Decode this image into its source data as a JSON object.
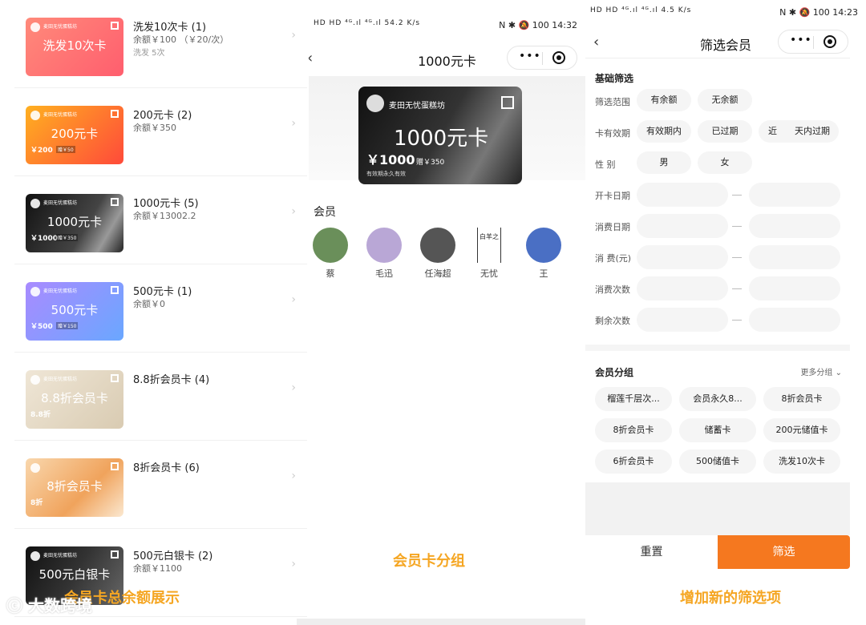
{
  "panel1": {
    "cards": [
      {
        "card_text": "洗发10次卡",
        "shop": "麦田无忧蛋糕坊",
        "title": "洗发10次卡 (1)",
        "sub": "余额￥100 （￥20/次）",
        "sub3": "洗发  5次",
        "bg": "linear-gradient(135deg,#ff8a7a,#ff5e6e)"
      },
      {
        "card_text": "200元卡",
        "shop": "麦田无忧蛋糕坊",
        "amount": "￥200",
        "gift": "赠￥50",
        "title": "200元卡 (2)",
        "sub": "余额￥350",
        "bg": "linear-gradient(135deg,#ffb020,#ff4a3a)"
      },
      {
        "card_text": "1000元卡",
        "shop": "麦田无忧蛋糕坊",
        "amount": "￥1000",
        "gift": "赠￥350",
        "title": "1000元卡 (5)",
        "sub": "余额￥13002.2",
        "bg": "linear-gradient(120deg,#111,#444 60%,#999 80%,#222)"
      },
      {
        "card_text": "500元卡",
        "shop": "麦田无忧蛋糕坊",
        "amount": "￥500",
        "gift": "赠￥150",
        "title": "500元卡 (1)",
        "sub": "余额￥0",
        "bg": "linear-gradient(135deg,#a98bff,#6aa7ff)"
      },
      {
        "card_text": "8.8折会员卡",
        "shop": "麦田无忧蛋糕坊",
        "amount": "8.8折",
        "title": "8.8折会员卡 (4)",
        "sub": "",
        "bg": "linear-gradient(135deg,#efe6d6,#d9cbb2)"
      },
      {
        "card_text": "8折会员卡",
        "shop": "",
        "amount": "8折",
        "title": "8折会员卡 (6)",
        "sub": "",
        "bg": "linear-gradient(135deg,#f9d7ad,#f0a35c 60%,#fbe8d0)"
      },
      {
        "card_text": "500元白银卡",
        "shop": "麦田无忧蛋糕坊",
        "title": "500元白银卡 (2)",
        "sub": "余额￥1100",
        "bg": "linear-gradient(120deg,#111,#333,#666)"
      }
    ],
    "caption": "会员卡总余额展示",
    "watermark": "大数跨境"
  },
  "panel2": {
    "status_left": "HD HD ⁴ᴳ.ıl ⁴ᴳ.ıl 54.2 K/s",
    "status_right": "N ✱ 🔕 100 14:32",
    "title": "1000元卡",
    "card": {
      "shop": "麦田无忧蛋糕坊",
      "card_text": "1000元卡",
      "amount": "￥1000",
      "gift": "赠￥350",
      "valid": "有效期永久有效"
    },
    "section": "会员",
    "members": [
      {
        "name": "蔡",
        "color": "#6a8f5a"
      },
      {
        "name": "毛迅",
        "color": "#b9a7d6"
      },
      {
        "name": "任海超",
        "color": "#555"
      },
      {
        "name": "无忧",
        "seal": "白羊之"
      },
      {
        "name": "王",
        "color": "#4a6fc4"
      }
    ],
    "caption": "会员卡分组"
  },
  "panel3": {
    "status_left": "HD HD ⁴ᴳ.ıl ⁴ᴳ.ıl 4.5 K/s",
    "status_right": "N ✱ 🔕 100 14:23",
    "title": "筛选会员",
    "basic_title": "基础筛选",
    "rows": {
      "range": {
        "label": "筛选范围",
        "opts": [
          "有余额",
          "无余额"
        ]
      },
      "validity": {
        "label": "卡有效期",
        "opts": [
          "有效期内",
          "已过期",
          "近",
          "天内过期"
        ]
      },
      "gender": {
        "label": "性    别",
        "opts": [
          "男",
          "女"
        ]
      },
      "open_date": {
        "label": "开卡日期"
      },
      "consume_date": {
        "label": "消费日期"
      },
      "consume_amount": {
        "label": "消 费(元)"
      },
      "consume_count": {
        "label": "消费次数"
      },
      "remain_count": {
        "label": "剩余次数"
      }
    },
    "group_title": "会员分组",
    "more_groups": "更多分组 ⌄",
    "groups": [
      "榴莲千层次...",
      "会员永久8...",
      "8折会员卡",
      "8折会员卡",
      "储蓄卡",
      "200元储值卡",
      "6折会员卡",
      "500储值卡",
      "洗发10次卡"
    ],
    "reset": "重置",
    "filter": "筛选",
    "accent": "#f5781f",
    "caption": "增加新的筛选项"
  }
}
